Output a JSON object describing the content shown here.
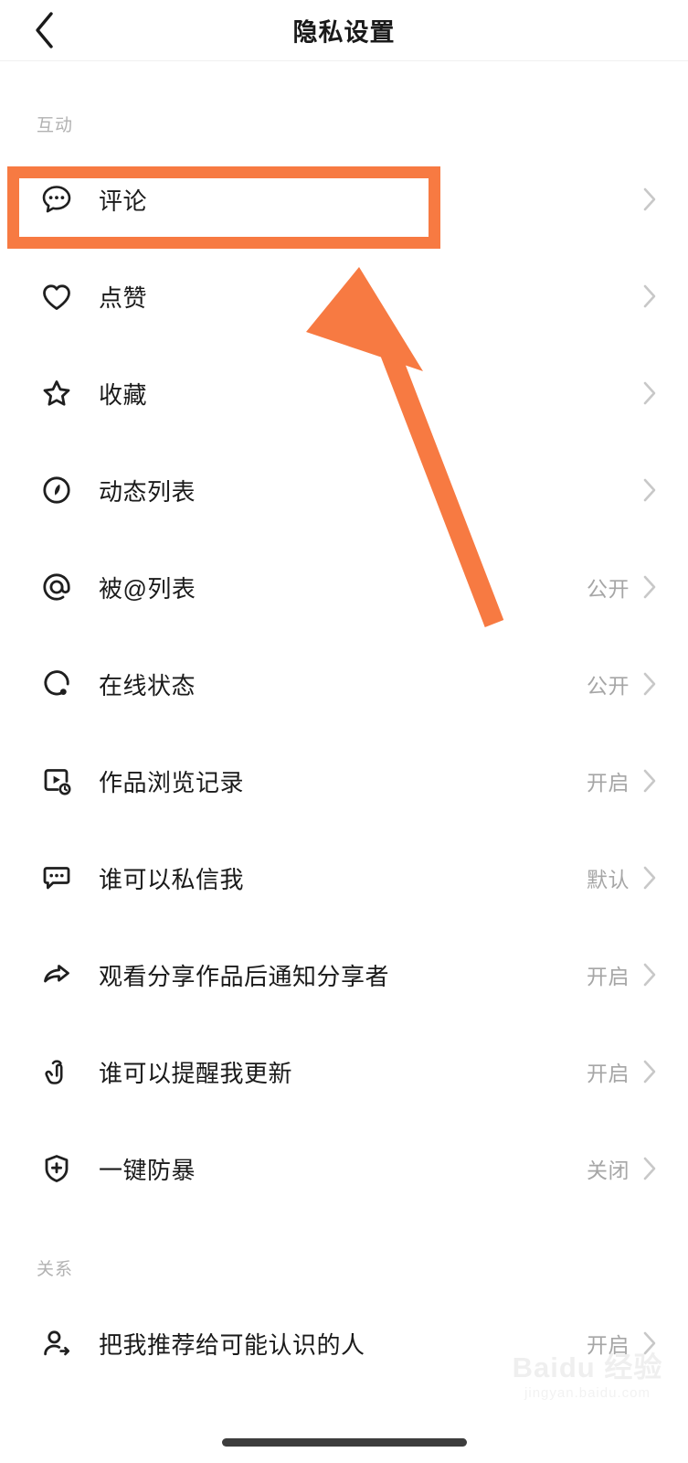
{
  "header": {
    "back_icon": "chevron-left-icon",
    "title": "隐私设置"
  },
  "sections": [
    {
      "label": "互动",
      "rows": [
        {
          "icon": "comment-bubble-icon",
          "label": "评论",
          "value": "",
          "highlighted": true
        },
        {
          "icon": "heart-icon",
          "label": "点赞",
          "value": ""
        },
        {
          "icon": "star-icon",
          "label": "收藏",
          "value": ""
        },
        {
          "icon": "compass-icon",
          "label": "动态列表",
          "value": ""
        },
        {
          "icon": "at-mention-icon",
          "label": "被@列表",
          "value": "公开"
        },
        {
          "icon": "online-status-icon",
          "label": "在线状态",
          "value": "公开"
        },
        {
          "icon": "video-history-icon",
          "label": "作品浏览记录",
          "value": "开启"
        },
        {
          "icon": "message-box-icon",
          "label": "谁可以私信我",
          "value": "默认"
        },
        {
          "icon": "share-arrow-icon",
          "label": "观看分享作品后通知分享者",
          "value": "开启"
        },
        {
          "icon": "tap-hand-icon",
          "label": "谁可以提醒我更新",
          "value": "开启"
        },
        {
          "icon": "shield-plus-icon",
          "label": "一键防暴",
          "value": "关闭"
        }
      ]
    },
    {
      "label": "关系",
      "rows": [
        {
          "icon": "person-add-icon",
          "label": "把我推荐给可能认识的人",
          "value": "开启"
        }
      ]
    }
  ],
  "annotation": {
    "color": "#f77a42",
    "highlight_target": "评论",
    "arrow": "pointer-arrow"
  },
  "watermark": {
    "main": "Baidu 经验",
    "sub": "jingyan.baidu.com"
  },
  "colors": {
    "accent": "#f77a42",
    "label_text": "#1a1a1a",
    "value_text": "#a6a6a6",
    "section_text": "#b2b2b2",
    "background": "#ffffff"
  }
}
